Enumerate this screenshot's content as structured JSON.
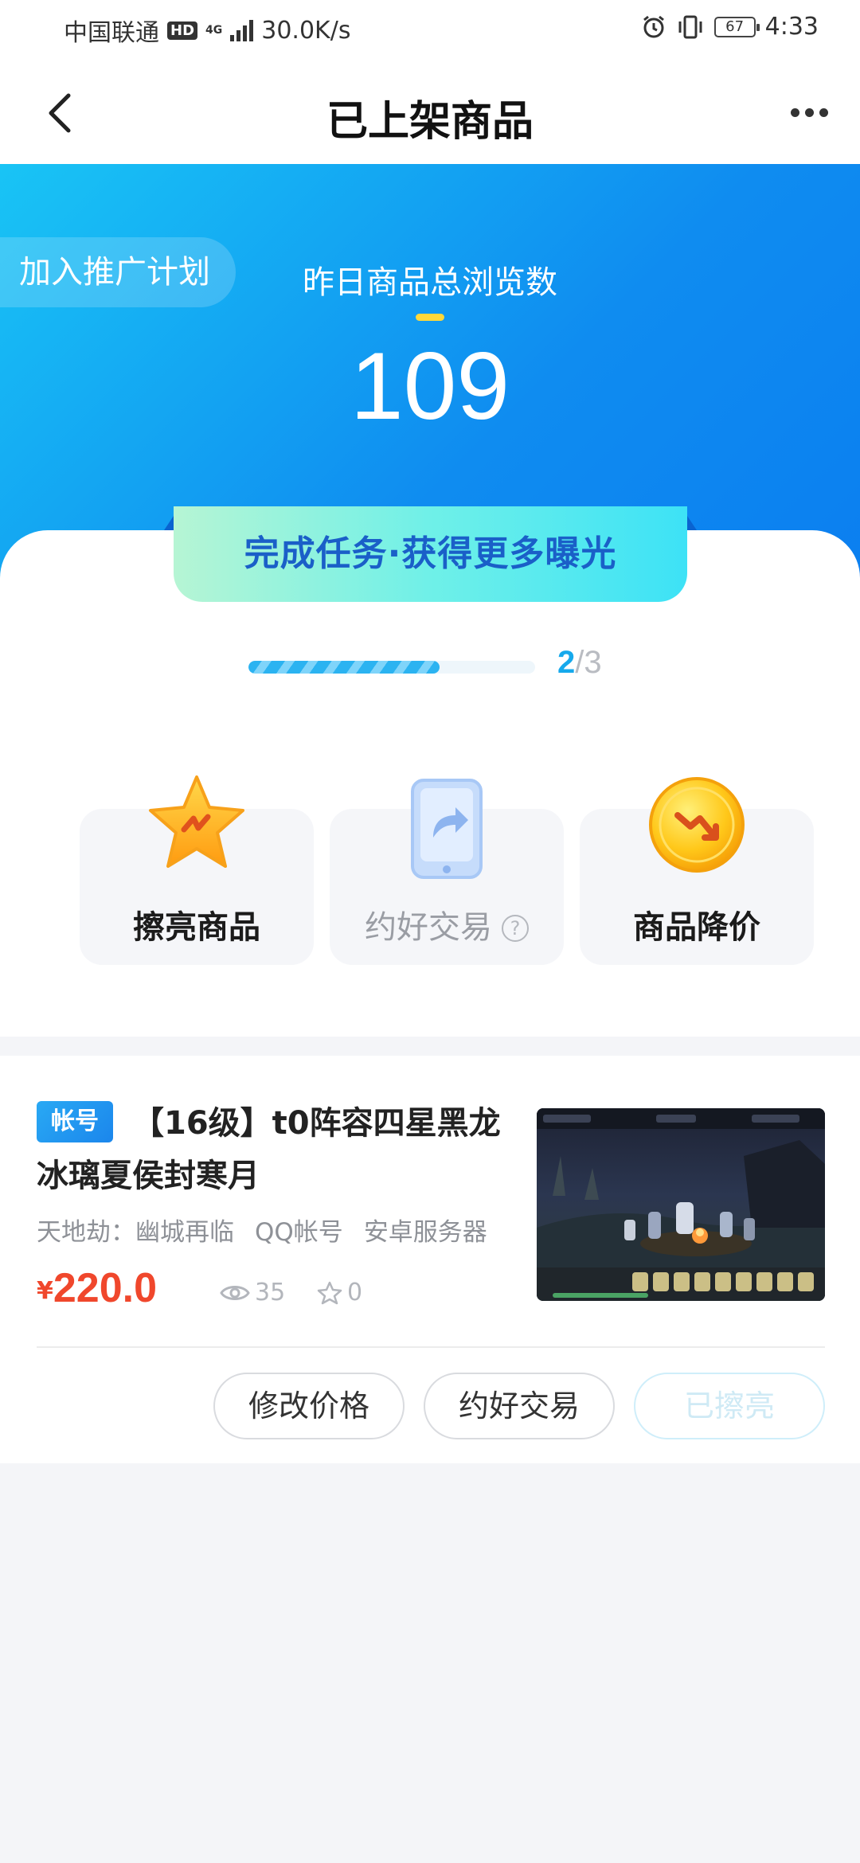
{
  "status_bar": {
    "carrier": "中国联通",
    "hd": "HD",
    "net_type": "4G",
    "speed": "30.0K/s",
    "battery": "67",
    "time": "4:33"
  },
  "nav": {
    "title": "已上架商品",
    "back_icon": "chevron-left-icon",
    "more_icon": "more-horizontal-icon"
  },
  "hero": {
    "promo_label": "加入推广计划",
    "label": "昨日商品总浏览数",
    "count": "109"
  },
  "tasks": {
    "banner": "完成任务·获得更多曝光",
    "progress": {
      "done": "2",
      "total": "/3",
      "fraction": 0.667
    },
    "items": [
      {
        "label": "擦亮商品",
        "icon": "star-icon"
      },
      {
        "label": "约好交易",
        "icon": "phone-share-icon"
      },
      {
        "label": "商品降价",
        "icon": "price-down-coin-icon"
      }
    ],
    "help_mark": "?"
  },
  "product": {
    "badge": "帐号",
    "title": "【16级】t0阵容四星黑龙冰璃夏侯封寒月",
    "tags": [
      "天地劫：幽城再临",
      "QQ帐号",
      "安卓服务器"
    ],
    "currency": "¥",
    "price": "220.0",
    "views": "35",
    "favorites": "0",
    "buttons": {
      "edit_price": "修改价格",
      "deal": "约好交易",
      "polished": "已擦亮"
    }
  },
  "colors": {
    "accent": "#16a9ec",
    "price": "#f0472c",
    "hero_start": "#19c4f5",
    "hero_end": "#0b7ff0"
  }
}
